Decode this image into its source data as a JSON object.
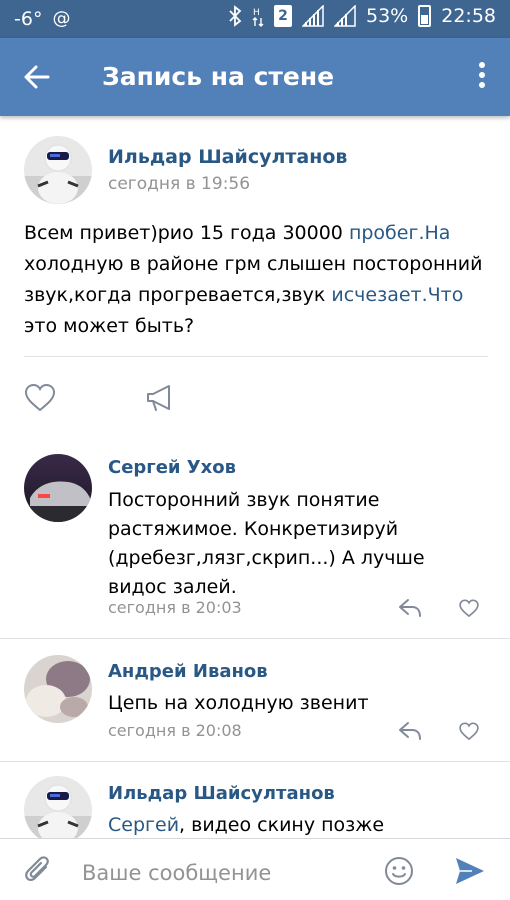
{
  "status_bar": {
    "temperature": "-6°",
    "sim_badge": "2",
    "battery": "53%",
    "time": "22:58"
  },
  "app_bar": {
    "title": "Запись на стене"
  },
  "post": {
    "author": "Ильдар Шайсултанов",
    "time": "сегодня в 19:56",
    "text_lines": [
      [
        "Всем привет)рио 15 года 30000 ",
        "пробег.На"
      ],
      [
        "холодную в районе грм слышен посторонний"
      ],
      [
        "звук,когда прогревается,звук ",
        "исчезает.Что"
      ],
      [
        "это может быть?"
      ]
    ]
  },
  "comments": [
    {
      "author": "Сергей Ухов",
      "text_lines": [
        "Посторонний звук понятие",
        "растяжимое. Конкретизируй",
        "(дребезг,лязг,скрип...) А лучше",
        "видос залей."
      ],
      "time": "сегодня в 20:03"
    },
    {
      "author": "Андрей Иванов",
      "text_lines": [
        "Цепь на холодную звенит"
      ],
      "time": "сегодня в 20:08"
    },
    {
      "author": "Ильдар Шайсултанов",
      "mention": "Сергей",
      "text_rest": ", видео скину позже"
    }
  ],
  "input": {
    "placeholder": "Ваше сообщение"
  },
  "colors": {
    "status_bar": "#3f6591",
    "app_bar": "#5181b8",
    "link": "#2a5885",
    "secondary_text": "#939393",
    "send": "#5181b8"
  },
  "icons": {
    "back": "arrow-left-icon",
    "more": "more-vertical-icon",
    "like": "heart-icon",
    "share": "megaphone-icon",
    "reply": "reply-arrow-icon",
    "attach": "paperclip-icon",
    "emoji": "smiley-icon",
    "send": "send-icon"
  }
}
